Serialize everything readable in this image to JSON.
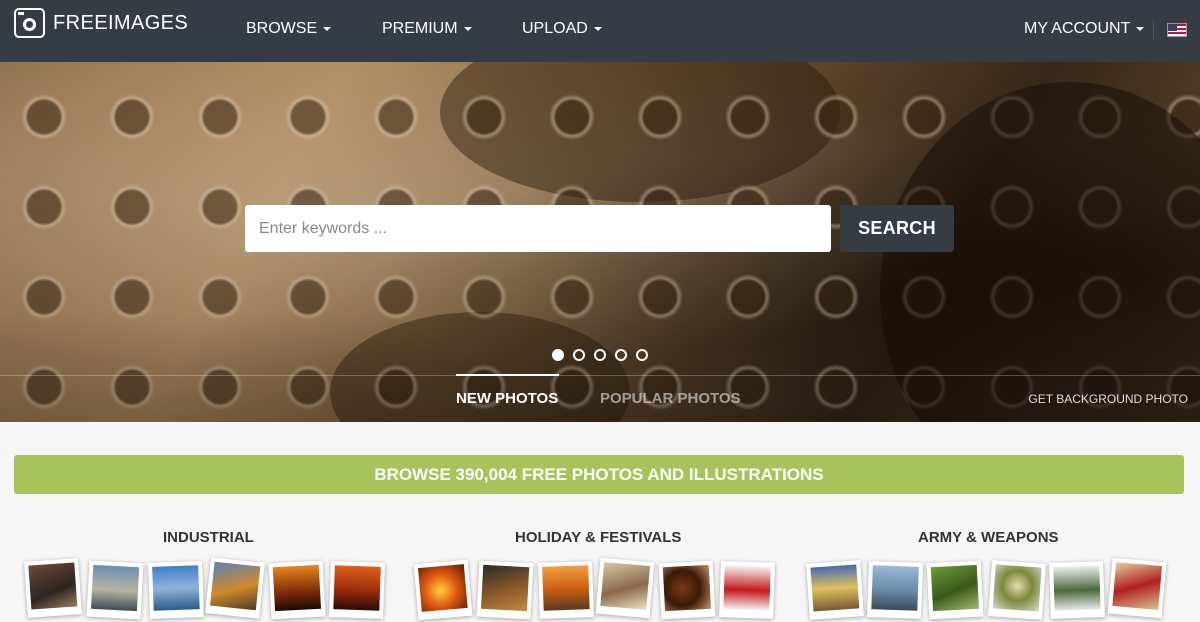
{
  "nav": {
    "logo_text": "FREEIMAGES",
    "browse": "BROWSE",
    "premium": "PREMIUM",
    "upload": "UPLOAD",
    "my_account": "MY ACCOUNT"
  },
  "hero": {
    "search_placeholder": "Enter keywords ...",
    "search_button": "SEARCH",
    "slides_count": 5,
    "active_slide": 1,
    "tab_new": "NEW PHOTOS",
    "tab_popular": "POPULAR PHOTOS",
    "get_background": "GET BACKGROUND PHOTO"
  },
  "browse_banner": "BROWSE 390,004 FREE PHOTOS AND ILLUSTRATIONS",
  "categories": [
    {
      "title": "INDUSTRIAL"
    },
    {
      "title": "HOLIDAY & FESTIVALS"
    },
    {
      "title": "ARMY & WEAPONS"
    }
  ],
  "colors": {
    "nav_bg": "#363c44",
    "browse_green": "#a8c35c",
    "page_bg": "#f6f6f6"
  }
}
